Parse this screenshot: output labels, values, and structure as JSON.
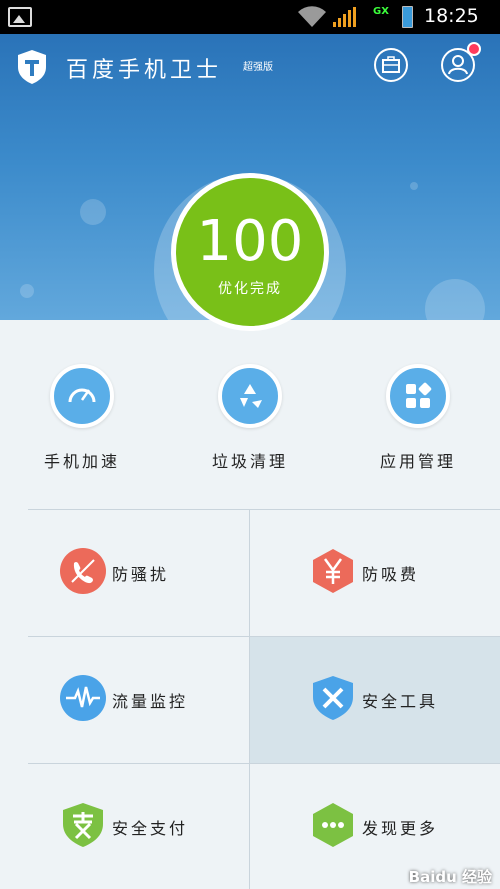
{
  "status_bar": {
    "network": "3G",
    "data_type": "GX",
    "time": "18:25"
  },
  "header": {
    "app_title": "百度手机卫士",
    "app_subtitle": "超强版"
  },
  "score": {
    "value": "100",
    "label": "优化完成",
    "color": "#79c018"
  },
  "quick_actions": [
    {
      "label": "手机加速",
      "icon": "speedometer-icon"
    },
    {
      "label": "垃圾清理",
      "icon": "recycle-icon"
    },
    {
      "label": "应用管理",
      "icon": "apps-grid-icon"
    }
  ],
  "features": [
    {
      "label": "防骚扰",
      "icon": "no-call-icon",
      "color": "#ec6a5a"
    },
    {
      "label": "防吸费",
      "icon": "yen-hexagon-icon",
      "color": "#ec6a5a"
    },
    {
      "label": "流量监控",
      "icon": "traffic-wave-icon",
      "color": "#4aa3e8"
    },
    {
      "label": "安全工具",
      "icon": "shield-wrench-icon",
      "color": "#4aa3e8"
    },
    {
      "label": "安全支付",
      "icon": "shield-pay-icon",
      "color": "#7cc142"
    },
    {
      "label": "发现更多",
      "icon": "more-hexagon-icon",
      "color": "#7cc142"
    }
  ],
  "watermark": "Baidu 经验"
}
